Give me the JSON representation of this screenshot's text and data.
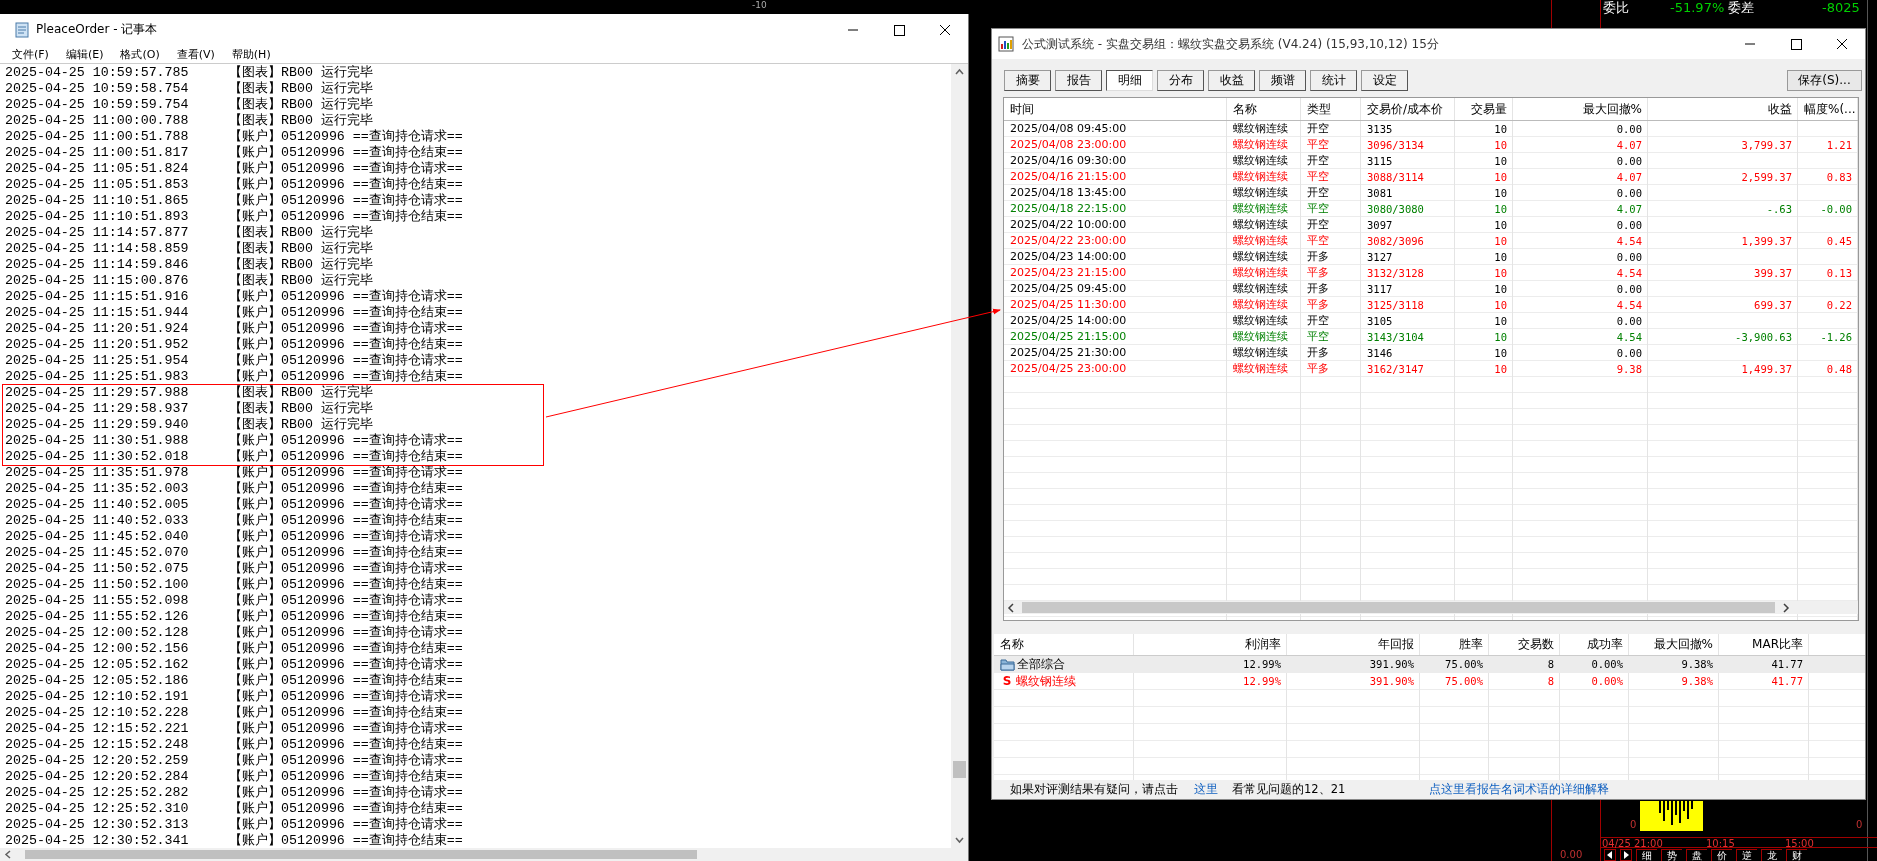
{
  "terminal": {
    "scale_label": "-10",
    "quote": {
      "ratio_label": "委比",
      "ratio": "-51.97%",
      "diff_label": "委差",
      "diff": "-8025"
    },
    "chart_zero_labels": [
      "0",
      "0"
    ],
    "time_labels": [
      "04/25 21:00",
      "10:15",
      "15:00"
    ],
    "price_label": "0.00",
    "tabs": [
      "细",
      "势",
      "盘",
      "价",
      "逆",
      "龙",
      "财"
    ]
  },
  "notepad": {
    "title": "PleaceOrder - 记事本",
    "menu": [
      "文件(F)",
      "编辑(E)",
      "格式(O)",
      "查看(V)",
      "帮助(H)"
    ],
    "lines": [
      {
        "time": "2025-04-25 10:59:57.785",
        "message": "【图表】RB00 运行完毕",
        "highlighted": false
      },
      {
        "time": "2025-04-25 10:59:58.754",
        "message": "【图表】RB00 运行完毕",
        "highlighted": false
      },
      {
        "time": "2025-04-25 10:59:59.754",
        "message": "【图表】RB00 运行完毕",
        "highlighted": false
      },
      {
        "time": "2025-04-25 11:00:00.788",
        "message": "【图表】RB00 运行完毕",
        "highlighted": false
      },
      {
        "time": "2025-04-25 11:00:51.788",
        "message": "【账户】05120996 ==查询持仓请求==",
        "highlighted": false
      },
      {
        "time": "2025-04-25 11:00:51.817",
        "message": "【账户】05120996 ==查询持仓结束==",
        "highlighted": false
      },
      {
        "time": "2025-04-25 11:05:51.824",
        "message": "【账户】05120996 ==查询持仓请求==",
        "highlighted": false
      },
      {
        "time": "2025-04-25 11:05:51.853",
        "message": "【账户】05120996 ==查询持仓结束==",
        "highlighted": false
      },
      {
        "time": "2025-04-25 11:10:51.865",
        "message": "【账户】05120996 ==查询持仓请求==",
        "highlighted": false
      },
      {
        "time": "2025-04-25 11:10:51.893",
        "message": "【账户】05120996 ==查询持仓结束==",
        "highlighted": false
      },
      {
        "time": "2025-04-25 11:14:57.877",
        "message": "【图表】RB00 运行完毕",
        "highlighted": false
      },
      {
        "time": "2025-04-25 11:14:58.859",
        "message": "【图表】RB00 运行完毕",
        "highlighted": false
      },
      {
        "time": "2025-04-25 11:14:59.846",
        "message": "【图表】RB00 运行完毕",
        "highlighted": false
      },
      {
        "time": "2025-04-25 11:15:00.876",
        "message": "【图表】RB00 运行完毕",
        "highlighted": false
      },
      {
        "time": "2025-04-25 11:15:51.916",
        "message": "【账户】05120996 ==查询持仓请求==",
        "highlighted": false
      },
      {
        "time": "2025-04-25 11:15:51.944",
        "message": "【账户】05120996 ==查询持仓结束==",
        "highlighted": false
      },
      {
        "time": "2025-04-25 11:20:51.924",
        "message": "【账户】05120996 ==查询持仓请求==",
        "highlighted": false
      },
      {
        "time": "2025-04-25 11:20:51.952",
        "message": "【账户】05120996 ==查询持仓结束==",
        "highlighted": false
      },
      {
        "time": "2025-04-25 11:25:51.954",
        "message": "【账户】05120996 ==查询持仓请求==",
        "highlighted": false
      },
      {
        "time": "2025-04-25 11:25:51.983",
        "message": "【账户】05120996 ==查询持仓结束==",
        "highlighted": false
      },
      {
        "time": "2025-04-25 11:29:57.988",
        "message": "【图表】RB00 运行完毕",
        "highlighted": true
      },
      {
        "time": "2025-04-25 11:29:58.937",
        "message": "【图表】RB00 运行完毕",
        "highlighted": true
      },
      {
        "time": "2025-04-25 11:29:59.940",
        "message": "【图表】RB00 运行完毕",
        "highlighted": true
      },
      {
        "time": "2025-04-25 11:30:51.988",
        "message": "【账户】05120996 ==查询持仓请求==",
        "highlighted": true
      },
      {
        "time": "2025-04-25 11:30:52.018",
        "message": "【账户】05120996 ==查询持仓结束==",
        "highlighted": true
      },
      {
        "time": "2025-04-25 11:35:51.978",
        "message": "【账户】05120996 ==查询持仓请求==",
        "highlighted": false
      },
      {
        "time": "2025-04-25 11:35:52.003",
        "message": "【账户】05120996 ==查询持仓结束==",
        "highlighted": false
      },
      {
        "time": "2025-04-25 11:40:52.005",
        "message": "【账户】05120996 ==查询持仓请求==",
        "highlighted": false
      },
      {
        "time": "2025-04-25 11:40:52.033",
        "message": "【账户】05120996 ==查询持仓结束==",
        "highlighted": false
      },
      {
        "time": "2025-04-25 11:45:52.040",
        "message": "【账户】05120996 ==查询持仓请求==",
        "highlighted": false
      },
      {
        "time": "2025-04-25 11:45:52.070",
        "message": "【账户】05120996 ==查询持仓结束==",
        "highlighted": false
      },
      {
        "time": "2025-04-25 11:50:52.075",
        "message": "【账户】05120996 ==查询持仓请求==",
        "highlighted": false
      },
      {
        "time": "2025-04-25 11:50:52.100",
        "message": "【账户】05120996 ==查询持仓结束==",
        "highlighted": false
      },
      {
        "time": "2025-04-25 11:55:52.098",
        "message": "【账户】05120996 ==查询持仓请求==",
        "highlighted": false
      },
      {
        "time": "2025-04-25 11:55:52.126",
        "message": "【账户】05120996 ==查询持仓结束==",
        "highlighted": false
      },
      {
        "time": "2025-04-25 12:00:52.128",
        "message": "【账户】05120996 ==查询持仓请求==",
        "highlighted": false
      },
      {
        "time": "2025-04-25 12:00:52.156",
        "message": "【账户】05120996 ==查询持仓结束==",
        "highlighted": false
      },
      {
        "time": "2025-04-25 12:05:52.162",
        "message": "【账户】05120996 ==查询持仓请求==",
        "highlighted": false
      },
      {
        "time": "2025-04-25 12:05:52.186",
        "message": "【账户】05120996 ==查询持仓结束==",
        "highlighted": false
      },
      {
        "time": "2025-04-25 12:10:52.191",
        "message": "【账户】05120996 ==查询持仓请求==",
        "highlighted": false
      },
      {
        "time": "2025-04-25 12:10:52.228",
        "message": "【账户】05120996 ==查询持仓结束==",
        "highlighted": false
      },
      {
        "time": "2025-04-25 12:15:52.221",
        "message": "【账户】05120996 ==查询持仓请求==",
        "highlighted": false
      },
      {
        "time": "2025-04-25 12:15:52.248",
        "message": "【账户】05120996 ==查询持仓结束==",
        "highlighted": false
      },
      {
        "time": "2025-04-25 12:20:52.259",
        "message": "【账户】05120996 ==查询持仓请求==",
        "highlighted": false
      },
      {
        "time": "2025-04-25 12:20:52.284",
        "message": "【账户】05120996 ==查询持仓结束==",
        "highlighted": false
      },
      {
        "time": "2025-04-25 12:25:52.282",
        "message": "【账户】05120996 ==查询持仓请求==",
        "highlighted": false
      },
      {
        "time": "2025-04-25 12:25:52.310",
        "message": "【账户】05120996 ==查询持仓结束==",
        "highlighted": false
      },
      {
        "time": "2025-04-25 12:30:52.313",
        "message": "【账户】05120996 ==查询持仓请求==",
        "highlighted": false
      },
      {
        "time": "2025-04-25 12:30:52.341",
        "message": "【账户】05120996 ==查询持仓结束==",
        "highlighted": false
      }
    ]
  },
  "test_window": {
    "title": "公式测试系统 - 实盘交易组：螺纹实盘交易系统 (V4.24) (15,93,10,12) 15分",
    "tabs": [
      {
        "label": "摘要",
        "selected": false
      },
      {
        "label": "报告",
        "selected": false
      },
      {
        "label": "明细",
        "selected": true
      },
      {
        "label": "分布",
        "selected": false
      },
      {
        "label": "收益",
        "selected": false
      },
      {
        "label": "频谱",
        "selected": false
      },
      {
        "label": "统计",
        "selected": false
      },
      {
        "label": "设定",
        "selected": false
      }
    ],
    "save_button": "保存(S)...",
    "columns": [
      "时间",
      "名称",
      "类型",
      "交易价/成本价",
      "交易量",
      "最大回撤%",
      "收益",
      "幅度%(..."
    ],
    "rows": [
      {
        "time": "2025/04/08 09:45:00",
        "name": "螺纹钢连续",
        "type": "开空",
        "price": "3135",
        "volume": "10",
        "max_drawdown": "0.00",
        "color": "#000000"
      },
      {
        "time": "2025/04/08 23:00:00",
        "name": "螺纹钢连续",
        "type": "平空",
        "price": "3096/3134",
        "volume": "10",
        "max_drawdown": "4.07",
        "profit": "3,799.37",
        "change": "1.21",
        "color": "#ff0000"
      },
      {
        "time": "2025/04/16 09:30:00",
        "name": "螺纹钢连续",
        "type": "开空",
        "price": "3115",
        "volume": "10",
        "max_drawdown": "0.00",
        "color": "#000000"
      },
      {
        "time": "2025/04/16 21:15:00",
        "name": "螺纹钢连续",
        "type": "平空",
        "price": "3088/3114",
        "volume": "10",
        "max_drawdown": "4.07",
        "profit": "2,599.37",
        "change": "0.83",
        "color": "#ff0000"
      },
      {
        "time": "2025/04/18 13:45:00",
        "name": "螺纹钢连续",
        "type": "开空",
        "price": "3081",
        "volume": "10",
        "max_drawdown": "0.00",
        "color": "#000000"
      },
      {
        "time": "2025/04/18 22:15:00",
        "name": "螺纹钢连续",
        "type": "平空",
        "price": "3080/3080",
        "volume": "10",
        "max_drawdown": "4.07",
        "profit": "-.63",
        "change": "-0.00",
        "color": "#008000"
      },
      {
        "time": "2025/04/22 10:00:00",
        "name": "螺纹钢连续",
        "type": "开空",
        "price": "3097",
        "volume": "10",
        "max_drawdown": "0.00",
        "color": "#000000"
      },
      {
        "time": "2025/04/22 23:00:00",
        "name": "螺纹钢连续",
        "type": "平空",
        "price": "3082/3096",
        "volume": "10",
        "max_drawdown": "4.54",
        "profit": "1,399.37",
        "change": "0.45",
        "color": "#ff0000"
      },
      {
        "time": "2025/04/23 14:00:00",
        "name": "螺纹钢连续",
        "type": "开多",
        "price": "3127",
        "volume": "10",
        "max_drawdown": "0.00",
        "color": "#000000"
      },
      {
        "time": "2025/04/23 21:15:00",
        "name": "螺纹钢连续",
        "type": "平多",
        "price": "3132/3128",
        "volume": "10",
        "max_drawdown": "4.54",
        "profit": "399.37",
        "change": "0.13",
        "color": "#ff0000"
      },
      {
        "time": "2025/04/25 09:45:00",
        "name": "螺纹钢连续",
        "type": "开多",
        "price": "3117",
        "volume": "10",
        "max_drawdown": "0.00",
        "color": "#000000"
      },
      {
        "time": "2025/04/25 11:30:00",
        "name": "螺纹钢连续",
        "type": "平多",
        "price": "3125/3118",
        "volume": "10",
        "max_drawdown": "4.54",
        "profit": "699.37",
        "change": "0.22",
        "color": "#ff0000"
      },
      {
        "time": "2025/04/25 14:00:00",
        "name": "螺纹钢连续",
        "type": "开空",
        "price": "3105",
        "volume": "10",
        "max_drawdown": "0.00",
        "color": "#000000"
      },
      {
        "time": "2025/04/25 21:15:00",
        "name": "螺纹钢连续",
        "type": "平空",
        "price": "3143/3104",
        "volume": "10",
        "max_drawdown": "4.54",
        "profit": "-3,900.63",
        "change": "-1.26",
        "color": "#008000"
      },
      {
        "time": "2025/04/25 21:30:00",
        "name": "螺纹钢连续",
        "type": "开多",
        "price": "3146",
        "volume": "10",
        "max_drawdown": "0.00",
        "color": "#000000"
      },
      {
        "time": "2025/04/25 23:00:00",
        "name": "螺纹钢连续",
        "type": "平多",
        "price": "3162/3147",
        "volume": "10",
        "max_drawdown": "9.38",
        "profit": "1,499.37",
        "change": "0.48",
        "color": "#ff0000"
      }
    ],
    "summary": {
      "columns": [
        "名称",
        "利润率",
        "年回报",
        "胜率",
        "交易数",
        "成功率",
        "最大回撤%",
        "MAR比率"
      ],
      "rows": [
        {
          "kind": "group",
          "selected": true,
          "color": "#000000",
          "name": "全部综合",
          "values": [
            "12.99%",
            "391.90%",
            "75.00%",
            "8",
            "0.00%",
            "9.38%",
            "41.77"
          ]
        },
        {
          "kind": "strategy",
          "selected": false,
          "color": "#ff0000",
          "marker": "S",
          "name": "螺纹钢连续",
          "values": [
            "12.99%",
            "391.90%",
            "75.00%",
            "8",
            "0.00%",
            "9.38%",
            "41.77"
          ]
        }
      ]
    },
    "footer": {
      "note": "如果对评测结果有疑问，请点击",
      "link": "这里",
      "note_2": "看常见问题的12、21",
      "help_link": "点这里看报告名词术语的详细解释"
    }
  }
}
